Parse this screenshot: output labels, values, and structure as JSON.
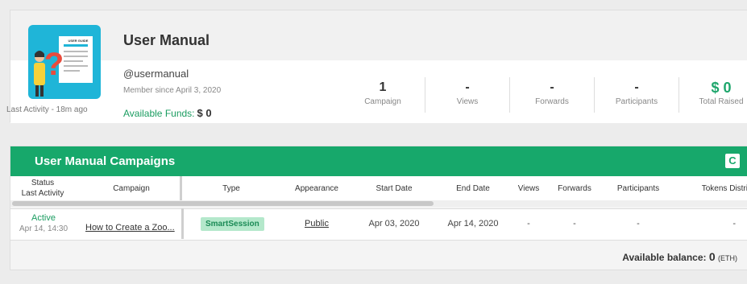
{
  "profile": {
    "name": "User Manual",
    "handle": "@usermanual",
    "member_since": "Member since April 3, 2020",
    "last_activity": "Last Activity - 18m ago",
    "funds_label": "Available Funds:",
    "funds_value": "$ 0",
    "avatar_caption": "USER GUIDE"
  },
  "stats": [
    {
      "value": "1",
      "label": "Campaign"
    },
    {
      "value": "-",
      "label": "Views"
    },
    {
      "value": "-",
      "label": "Forwards"
    },
    {
      "value": "-",
      "label": "Participants"
    },
    {
      "value": "$ 0",
      "label": "Total Raised"
    }
  ],
  "campaigns": {
    "title": "User Manual Campaigns",
    "headers": {
      "status": "Status",
      "last_activity": "Last Activity",
      "campaign": "Campaign",
      "type": "Type",
      "appearance": "Appearance",
      "start_date": "Start Date",
      "end_date": "End Date",
      "views": "Views",
      "forwards": "Forwards",
      "participants": "Participants",
      "tokens": "Tokens Distri"
    },
    "rows": [
      {
        "status": "Active",
        "time": "Apr 14, 14:30",
        "campaign": "How to Create a Zoo...",
        "type": "SmartSession",
        "appearance": "Public",
        "start_date": "Apr 03, 2020",
        "end_date": "Apr 14, 2020",
        "views": "-",
        "forwards": "-",
        "participants": "-",
        "tokens": "-"
      }
    ],
    "balance_label": "Available balance:",
    "balance_value": "0",
    "balance_unit": "(ETH)"
  },
  "colors": {
    "accent": "#17a86b",
    "badge_bg": "#b4e8cb"
  }
}
